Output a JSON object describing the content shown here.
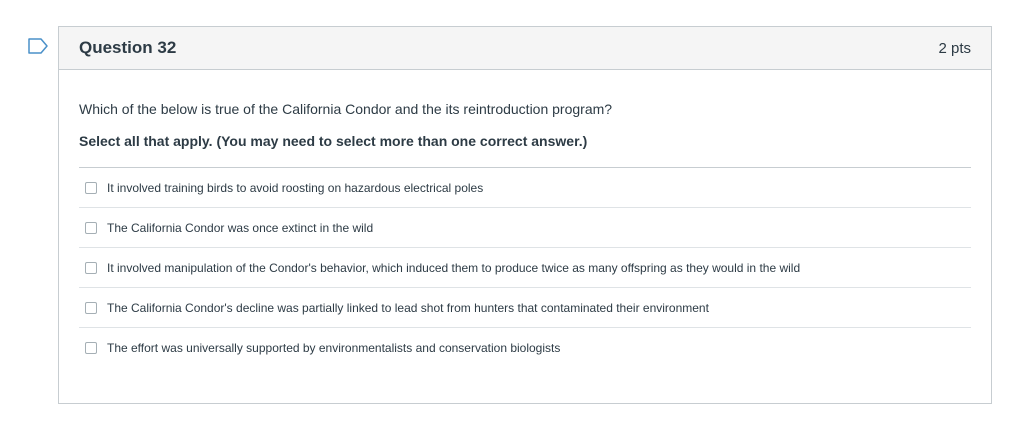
{
  "question": {
    "flag_icon": "flag-outline-icon",
    "title": "Question 32",
    "points": "2 pts",
    "text": "Which of the below is true of the California Condor and the its reintroduction program?",
    "instruction": "Select all that apply. (You may need to select more than one correct answer.)",
    "answers": [
      {
        "label": "It involved training birds to avoid roosting on hazardous electrical poles",
        "checked": false
      },
      {
        "label": "The California Condor was once extinct in the wild",
        "checked": false
      },
      {
        "label": "It involved manipulation of the Condor's behavior, which induced them to produce twice as many offspring as they would in the wild",
        "checked": false
      },
      {
        "label": "The California Condor's decline was partially linked to lead shot from hunters that contaminated their environment",
        "checked": false
      },
      {
        "label": "The effort was universally supported by environmentalists and conservation biologists",
        "checked": false
      }
    ]
  }
}
